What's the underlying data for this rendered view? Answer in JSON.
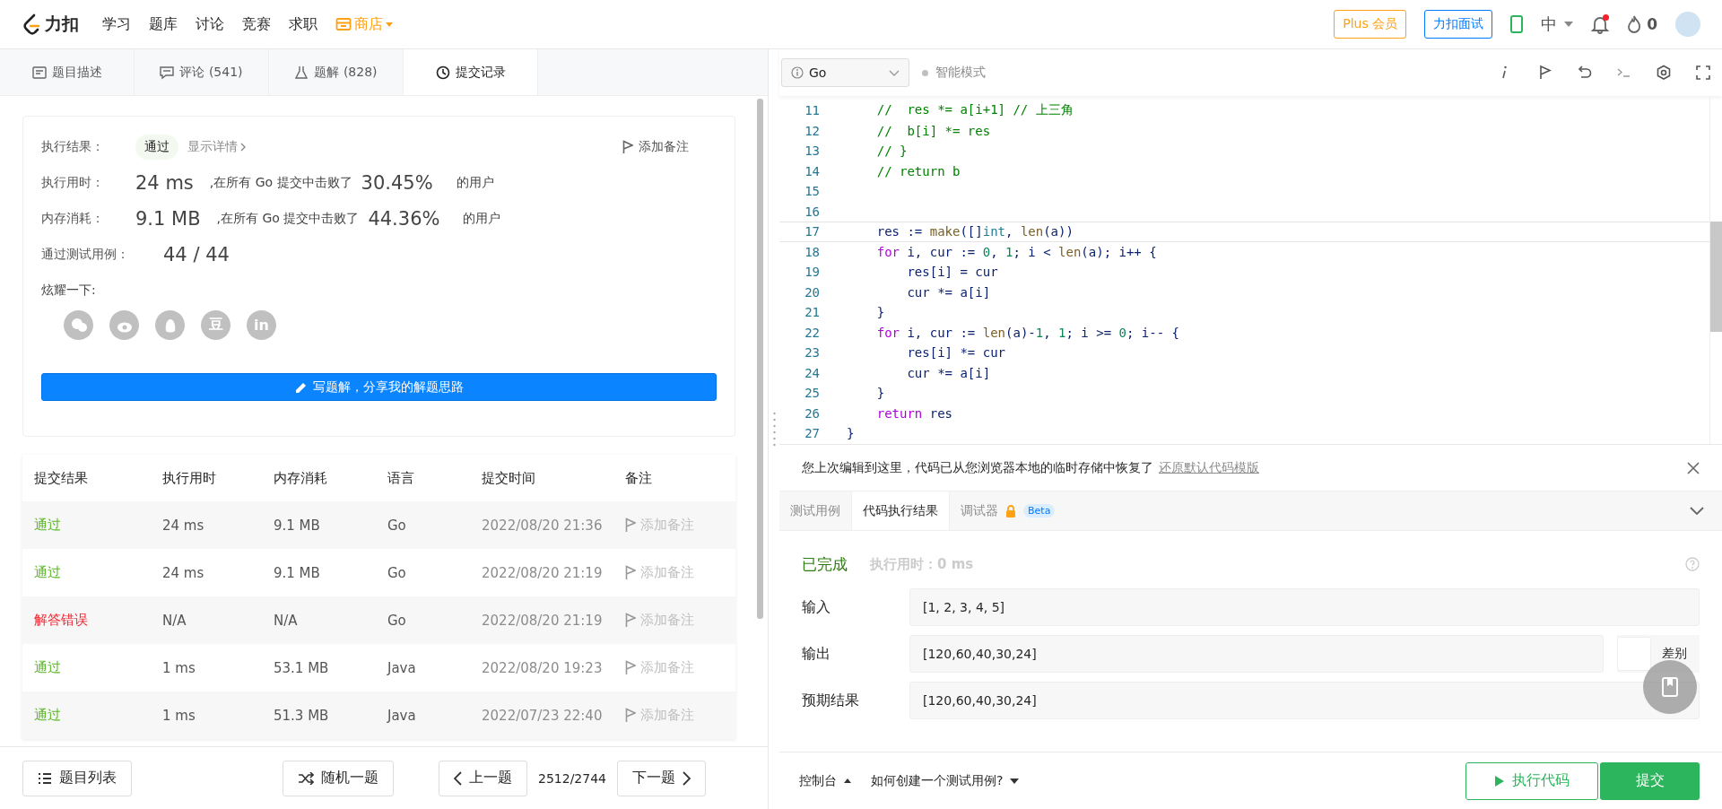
{
  "nav": {
    "logo": "力扣",
    "links": [
      {
        "label": "学习"
      },
      {
        "label": "题库"
      },
      {
        "label": "讨论"
      },
      {
        "label": "竞赛"
      },
      {
        "label": "求职"
      }
    ],
    "store": "商店",
    "plus": "Plus 会员",
    "interview": "力扣面试",
    "language": "中",
    "has_notification": true,
    "points": "0"
  },
  "left_tabs": [
    {
      "label": "题目描述",
      "selected": false
    },
    {
      "label": "评论 (541)",
      "selected": false
    },
    {
      "label": "题解 (828)",
      "selected": false
    },
    {
      "label": "提交记录",
      "selected": true
    }
  ],
  "result": {
    "status_label": "执行结果：",
    "status": "通过",
    "details": "显示详情",
    "note": "添加备注",
    "stats": [
      {
        "label": "执行用时：",
        "value": "24 ms",
        "text": ",在所有 Go 提交中击败了",
        "percent": "30.45%",
        "suffix": "的用户"
      },
      {
        "label": "内存消耗：",
        "value": "9.1 MB",
        "text": ",在所有 Go 提交中击败了",
        "percent": "44.36%",
        "suffix": "的用户"
      }
    ],
    "tests_label": "通过测试用例：",
    "tests": "44 / 44",
    "share_label": "炫耀一下:",
    "share": [
      {
        "kind": "wechat"
      },
      {
        "kind": "weibo"
      },
      {
        "kind": "qq"
      },
      {
        "kind": "douban",
        "label": "豆"
      },
      {
        "kind": "linkedin",
        "label": "in"
      }
    ],
    "write_button": "写题解，分享我的解题思路"
  },
  "table": {
    "columns": [
      "提交结果",
      "执行用时",
      "内存消耗",
      "语言",
      "提交时间",
      "备注"
    ],
    "rows": [
      {
        "result": "通过",
        "kind": "accepted",
        "time": "24 ms",
        "memory": "9.1 MB",
        "language": "Go",
        "submitted": "2022/08/20 21:36",
        "note": "添加备注"
      },
      {
        "result": "通过",
        "kind": "accepted",
        "time": "24 ms",
        "memory": "9.1 MB",
        "language": "Go",
        "submitted": "2022/08/20 21:19",
        "note": "添加备注"
      },
      {
        "result": "解答错误",
        "kind": "wrong",
        "time": "N/A",
        "memory": "N/A",
        "language": "Go",
        "submitted": "2022/08/20 21:19",
        "note": "添加备注"
      },
      {
        "result": "通过",
        "kind": "accepted",
        "time": "1 ms",
        "memory": "53.1 MB",
        "language": "Java",
        "submitted": "2022/08/20 19:23",
        "note": "添加备注"
      },
      {
        "result": "通过",
        "kind": "accepted",
        "time": "1 ms",
        "memory": "51.3 MB",
        "language": "Java",
        "submitted": "2022/07/23 22:40",
        "note": "添加备注"
      }
    ]
  },
  "left_footer": {
    "list_button": "题目列表",
    "random_button": "随机一题",
    "prev_button": "上一题",
    "counter": "2512/2744",
    "next_button": "下一题"
  },
  "editor": {
    "language": "Go",
    "smart_mode": {
      "label": "智能模式",
      "on": false
    },
    "lines": [
      {
        "number": "11",
        "current": false,
        "tokens": [
          {
            "kind": "comment",
            "text": "    //  res *= a[i+1] // 上三角"
          }
        ]
      },
      {
        "number": "12",
        "current": false,
        "tokens": [
          {
            "kind": "comment",
            "text": "    //  b[i] *= res"
          }
        ]
      },
      {
        "number": "13",
        "current": false,
        "tokens": [
          {
            "kind": "comment",
            "text": "    // }"
          }
        ]
      },
      {
        "number": "14",
        "current": false,
        "tokens": [
          {
            "kind": "comment",
            "text": "    // return b"
          }
        ]
      },
      {
        "number": "15",
        "current": false
      },
      {
        "number": "16",
        "current": false
      },
      {
        "number": "17",
        "current": true,
        "tokens": [
          {
            "kind": "plain",
            "text": "    res := "
          },
          {
            "kind": "builtin",
            "text": "make"
          },
          {
            "kind": "plain",
            "text": "([]"
          },
          {
            "kind": "type",
            "text": "int"
          },
          {
            "kind": "plain",
            "text": ", "
          },
          {
            "kind": "builtin",
            "text": "len"
          },
          {
            "kind": "plain",
            "text": "(a))"
          }
        ]
      },
      {
        "number": "18",
        "current": false,
        "tokens": [
          {
            "kind": "keyword",
            "text": "    for"
          },
          {
            "kind": "plain",
            "text": " i, cur := "
          },
          {
            "kind": "number",
            "text": "0"
          },
          {
            "kind": "plain",
            "text": ", "
          },
          {
            "kind": "number",
            "text": "1"
          },
          {
            "kind": "plain",
            "text": "; i < "
          },
          {
            "kind": "builtin",
            "text": "len"
          },
          {
            "kind": "plain",
            "text": "(a); i++ {"
          }
        ]
      },
      {
        "number": "19",
        "current": false,
        "tokens": [
          {
            "kind": "plain",
            "text": "        res[i] = cur"
          }
        ]
      },
      {
        "number": "20",
        "current": false,
        "tokens": [
          {
            "kind": "plain",
            "text": "        cur *= a[i]"
          }
        ]
      },
      {
        "number": "21",
        "current": false,
        "tokens": [
          {
            "kind": "plain",
            "text": "    }"
          }
        ]
      },
      {
        "number": "22",
        "current": false,
        "tokens": [
          {
            "kind": "keyword",
            "text": "    for"
          },
          {
            "kind": "plain",
            "text": " i, cur := "
          },
          {
            "kind": "builtin",
            "text": "len"
          },
          {
            "kind": "plain",
            "text": "(a)-"
          },
          {
            "kind": "number",
            "text": "1"
          },
          {
            "kind": "plain",
            "text": ", "
          },
          {
            "kind": "number",
            "text": "1"
          },
          {
            "kind": "plain",
            "text": "; i >= "
          },
          {
            "kind": "number",
            "text": "0"
          },
          {
            "kind": "plain",
            "text": "; i-- {"
          }
        ]
      },
      {
        "number": "23",
        "current": false,
        "tokens": [
          {
            "kind": "plain",
            "text": "        res[i] *= cur"
          }
        ]
      },
      {
        "number": "24",
        "current": false,
        "tokens": [
          {
            "kind": "plain",
            "text": "        cur *= a[i]"
          }
        ]
      },
      {
        "number": "25",
        "current": false,
        "tokens": [
          {
            "kind": "plain",
            "text": "    }"
          }
        ]
      },
      {
        "number": "26",
        "current": false,
        "tokens": [
          {
            "kind": "keyword",
            "text": "    return"
          },
          {
            "kind": "plain",
            "text": " res"
          }
        ]
      },
      {
        "number": "27",
        "current": false,
        "tokens": [
          {
            "kind": "plain",
            "text": "}"
          }
        ]
      }
    ]
  },
  "notice": {
    "text": "您上次编辑到这里，代码已从您浏览器本地的临时存储中恢复了",
    "link": "还原默认代码模版"
  },
  "console_tabs": [
    {
      "label": "测试用例",
      "selected": false
    },
    {
      "label": "代码执行结果",
      "selected": true
    },
    {
      "label": "调试器",
      "selected": false,
      "locked": true,
      "badge": "Beta"
    }
  ],
  "console": {
    "status": "已完成",
    "runtime": "执行用时：0 ms",
    "fields": [
      {
        "label": "输入",
        "value": "[1, 2, 3, 4, 5]"
      },
      {
        "label": "输出",
        "value": "[120,60,40,30,24]"
      },
      {
        "label": "预期结果",
        "value": "[120,60,40,30,24]"
      }
    ],
    "diff": {
      "label": "差别",
      "checked": false
    }
  },
  "right_footer": {
    "console_button": "控制台",
    "help_link": "如何创建一个测试用例?",
    "run_button": "执行代码",
    "submit_button": "提交"
  }
}
